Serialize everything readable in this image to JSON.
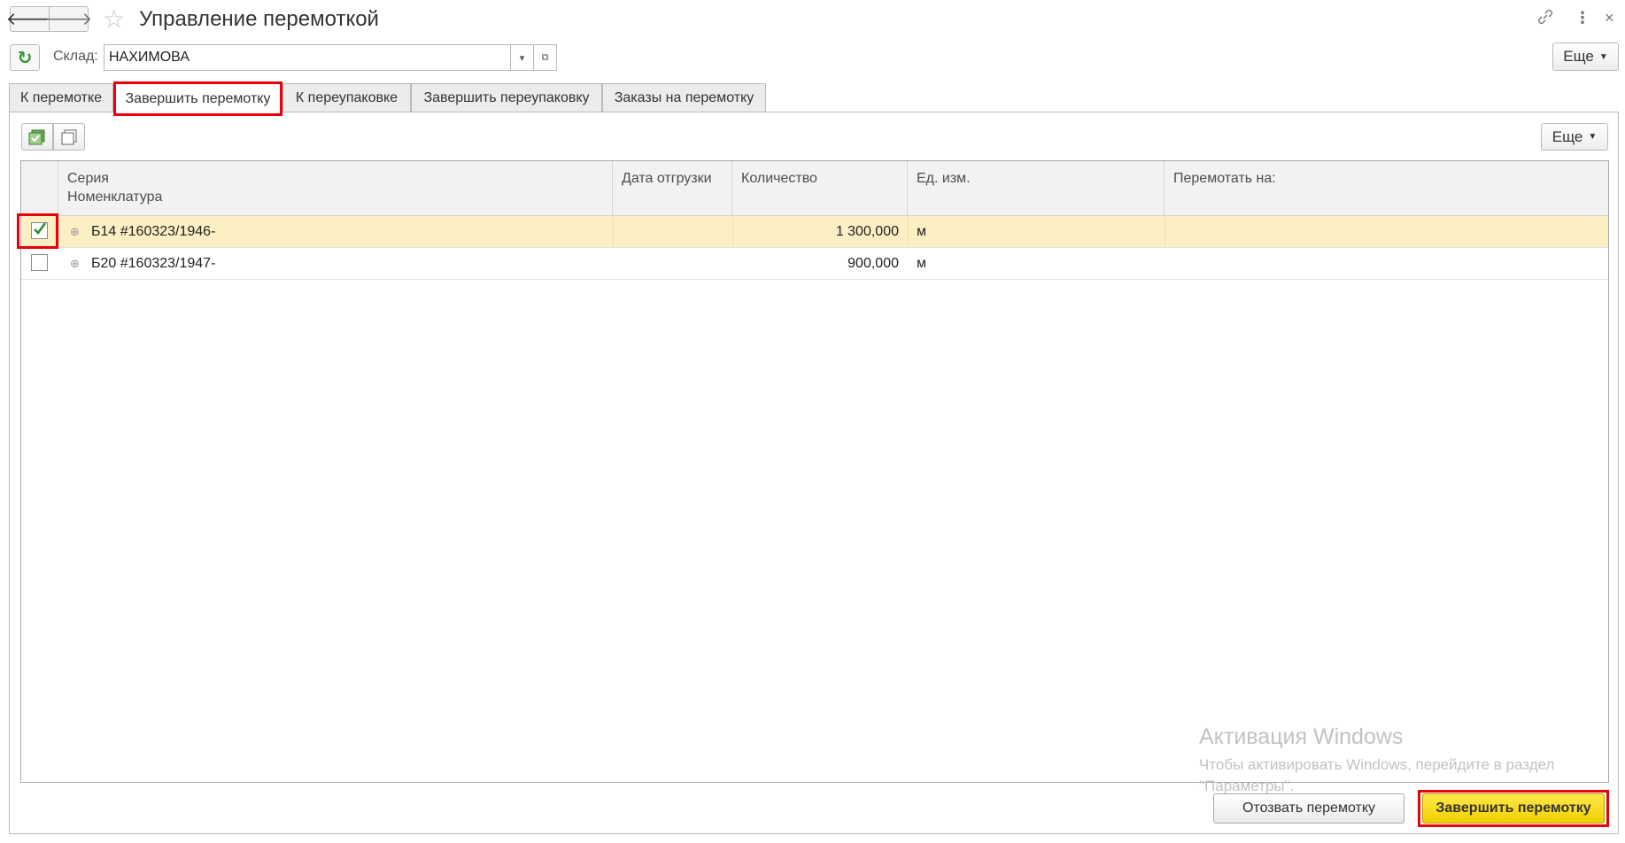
{
  "window": {
    "title": "Управление перемоткой",
    "back_icon": "arrow-left-icon",
    "forward_icon": "arrow-right-icon",
    "favorite_icon": "star-icon",
    "link_icon": "link-icon",
    "menu_icon": "more-vertical-icon",
    "close_icon": "close-icon"
  },
  "toolbar": {
    "sklad_label": "Склад:",
    "sklad_value": "НАХИМОВА",
    "more_label": "Еще"
  },
  "tabs": [
    {
      "label": "К перемотке",
      "active": false
    },
    {
      "label": "Завершить перемотку",
      "active": true
    },
    {
      "label": "К переупаковке",
      "active": false
    },
    {
      "label": "Завершить переупаковку",
      "active": false
    },
    {
      "label": "Заказы на перемотку",
      "active": false
    }
  ],
  "panel": {
    "more_label": "Еще"
  },
  "table": {
    "columns": {
      "seria": "Серия",
      "nomenklatura": "Номенклатура",
      "date": "Дата отгрузки",
      "qty": "Количество",
      "unit": "Ед. изм.",
      "rewind_to": "Перемотать на:"
    },
    "rows": [
      {
        "checked": true,
        "selected": true,
        "name": "Б14 #160323/1946-",
        "date": "",
        "qty": "1 300,000",
        "unit": "м",
        "rewind_to": ""
      },
      {
        "checked": false,
        "selected": false,
        "name": "Б20 #160323/1947-",
        "date": "",
        "qty": "900,000",
        "unit": "м",
        "rewind_to": ""
      }
    ]
  },
  "watermark": {
    "title": "Активация Windows",
    "text": "Чтобы активировать Windows, перейдите в раздел \"Параметры\"."
  },
  "buttons": {
    "recall": "Отозвать перемотку",
    "finish": "Завершить перемотку"
  },
  "colors": {
    "highlight_red": "#e8000b",
    "selected_row": "#fcefc4",
    "primary_button": "#f3cf00",
    "refresh_green": "#2e9a2e"
  }
}
